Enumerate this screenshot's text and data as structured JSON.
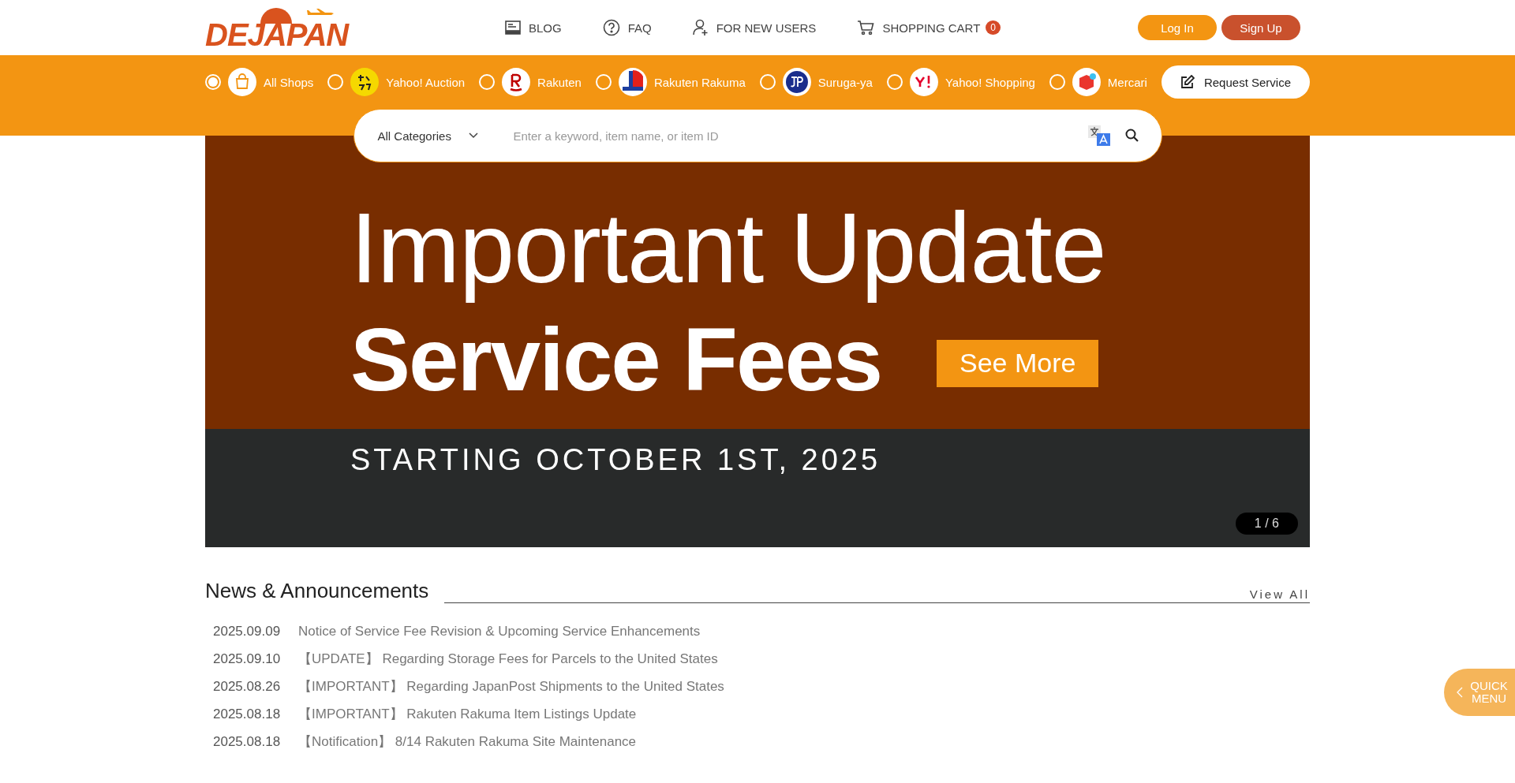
{
  "logo": {
    "text": "DEJAPAN"
  },
  "nav": [
    {
      "kind": "blog",
      "label": "BLOG"
    },
    {
      "kind": "faq",
      "label": "FAQ"
    },
    {
      "kind": "user",
      "label": "FOR NEW USERS"
    },
    {
      "kind": "cart",
      "label": "SHOPPING CART",
      "badge": "0"
    }
  ],
  "auth": {
    "login": "Log In",
    "signup": "Sign Up"
  },
  "shops": [
    {
      "kind": "bag",
      "label": "All Shops",
      "selected": true
    },
    {
      "kind": "auction",
      "label": "Yahoo! Auction",
      "selected": false
    },
    {
      "kind": "rakuten",
      "label": "Rakuten",
      "selected": false
    },
    {
      "kind": "rakuma",
      "label": "Rakuten Rakuma",
      "selected": false
    },
    {
      "kind": "suruga",
      "label": "Suruga-ya",
      "selected": false
    },
    {
      "kind": "yshopping",
      "label": "Yahoo! Shopping",
      "selected": false
    },
    {
      "kind": "mercari",
      "label": "Mercari",
      "selected": false
    }
  ],
  "request_service": "Request Service",
  "search": {
    "category": "All Categories",
    "placeholder": "Enter a keyword, item name, or item ID"
  },
  "banner": {
    "title": "Important Update",
    "subtitle": "Service Fees",
    "button": "See More",
    "date_line": "STARTING OCTOBER 1ST, 2025",
    "pager": "1 / 6"
  },
  "news": {
    "title": "News & Announcements",
    "view_all": "View All",
    "items": [
      {
        "date": "2025.09.09",
        "title": "Notice of Service Fee Revision & Upcoming Service Enhancements"
      },
      {
        "date": "2025.09.10",
        "title": "【UPDATE】 Regarding Storage Fees for Parcels to the United States"
      },
      {
        "date": "2025.08.26",
        "title": "【IMPORTANT】 Regarding JapanPost Shipments to the United States"
      },
      {
        "date": "2025.08.18",
        "title": "【IMPORTANT】 Rakuten Rakuma Item Listings Update"
      },
      {
        "date": "2025.08.18",
        "title": "【Notification】 8/14 Rakuten Rakuma Site Maintenance"
      }
    ]
  },
  "quick_menu": "QUICK MENU"
}
